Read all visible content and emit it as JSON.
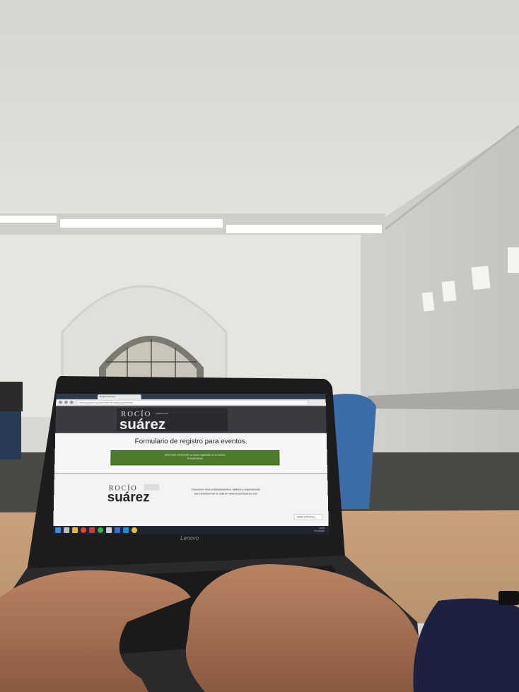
{
  "browser": {
    "tab_title": "Registro Eventos",
    "url": "www.rociosuarez.com/formulario-de-registro-para-eventos"
  },
  "site": {
    "logo_top": "ROCÍO",
    "logo_small": "FORMACIÓN",
    "logo_main": "suárez",
    "form_title": "Formulario de registro para eventos.",
    "success_line1": "¡MUCHAS GRACIAS! ya estás registrado en el evento.",
    "success_line2": "Te esperamos."
  },
  "footer": {
    "logo_top": "ROCÍO",
    "logo_main": "suárez",
    "text_line1": "Descubre otros entrenamientos, talleres y experiencias",
    "text_line2": "para transformar tu vida en www.RocioSuarez.com",
    "chat_label": "Hablar a WhatsApp"
  },
  "laptop": {
    "brand": "Lenovo"
  },
  "taskbar": {
    "time": "10:35",
    "date": "17/10/2016"
  },
  "colors": {
    "success_green": "#4d7a2b",
    "header_dark": "#3a3a40"
  }
}
